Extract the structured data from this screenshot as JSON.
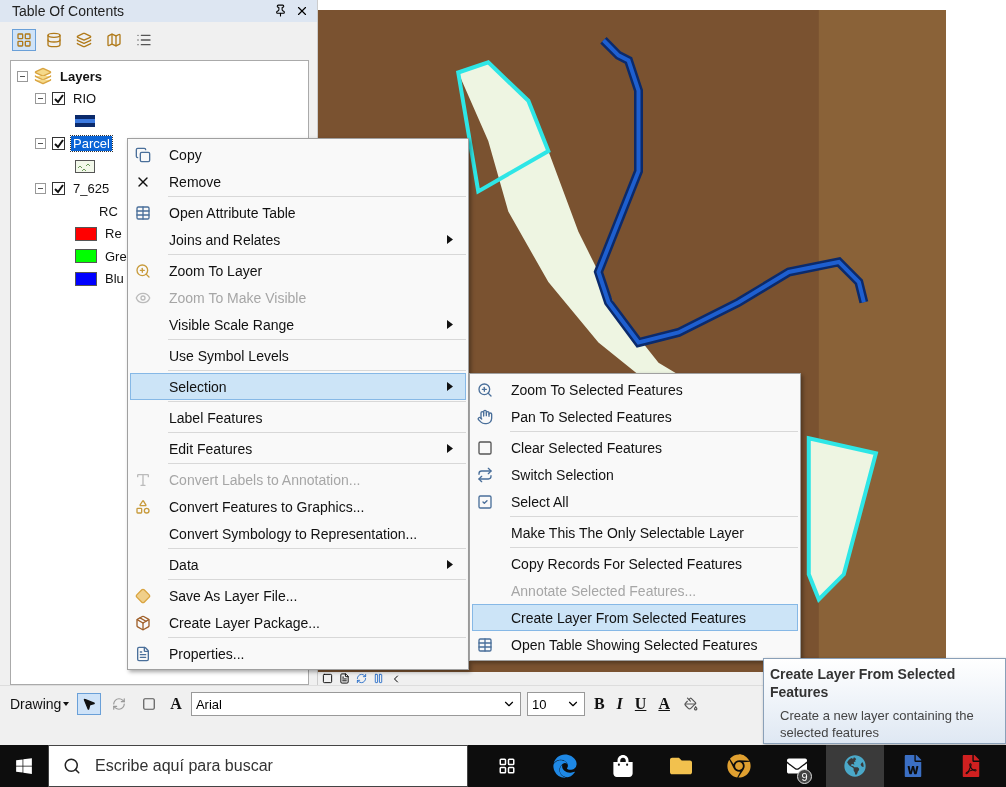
{
  "toc": {
    "title": "Table Of Contents",
    "tree": {
      "label": "Layers",
      "expanded": true,
      "children": [
        {
          "label": "RIO",
          "expanded": true,
          "checked": true,
          "selected": false,
          "children": [
            {
              "kind": "line"
            }
          ]
        },
        {
          "label": "Parcel",
          "expanded": true,
          "checked": true,
          "selected": true,
          "children": [
            {
              "kind": "pattern"
            }
          ]
        },
        {
          "label": "7_625",
          "expanded": true,
          "checked": true,
          "selected": false,
          "children": [
            {
              "kind": "heading",
              "label": "RC"
            },
            {
              "kind": "swatch",
              "label": "Re",
              "color": "#ff0000"
            },
            {
              "kind": "swatch",
              "label": "Gre",
              "color": "#00ff00"
            },
            {
              "kind": "swatch",
              "label": "Blu",
              "color": "#0000ff"
            }
          ]
        }
      ]
    }
  },
  "context_menu": {
    "groups": [
      [
        {
          "label": "Copy",
          "disabled": false,
          "has_submenu": false,
          "selected": false
        },
        {
          "label": "Remove",
          "disabled": false,
          "has_submenu": false,
          "selected": false
        }
      ],
      [
        {
          "label": "Open Attribute Table",
          "disabled": false,
          "has_submenu": false,
          "selected": false
        },
        {
          "label": "Joins and Relates",
          "disabled": false,
          "has_submenu": true,
          "selected": false
        }
      ],
      [
        {
          "label": "Zoom To Layer",
          "disabled": false,
          "has_submenu": false,
          "selected": false
        },
        {
          "label": "Zoom To Make Visible",
          "disabled": true,
          "has_submenu": false,
          "selected": false
        },
        {
          "label": "Visible Scale Range",
          "disabled": false,
          "has_submenu": true,
          "selected": false
        }
      ],
      [
        {
          "label": "Use Symbol Levels",
          "disabled": false,
          "has_submenu": false,
          "selected": false
        }
      ],
      [
        {
          "label": "Selection",
          "disabled": false,
          "has_submenu": true,
          "selected": true
        }
      ],
      [
        {
          "label": "Label Features",
          "disabled": false,
          "has_submenu": false,
          "selected": false
        }
      ],
      [
        {
          "label": "Edit Features",
          "disabled": false,
          "has_submenu": true,
          "selected": false
        }
      ],
      [
        {
          "label": "Convert Labels to Annotation...",
          "disabled": true,
          "has_submenu": false,
          "selected": false
        },
        {
          "label": "Convert Features to Graphics...",
          "disabled": false,
          "has_submenu": false,
          "selected": false
        },
        {
          "label": "Convert Symbology to Representation...",
          "disabled": false,
          "has_submenu": false,
          "selected": false
        }
      ],
      [
        {
          "label": "Data",
          "disabled": false,
          "has_submenu": true,
          "selected": false
        }
      ],
      [
        {
          "label": "Save As Layer File...",
          "disabled": false,
          "has_submenu": false,
          "selected": false
        },
        {
          "label": "Create Layer Package...",
          "disabled": false,
          "has_submenu": false,
          "selected": false
        }
      ],
      [
        {
          "label": "Properties...",
          "disabled": false,
          "has_submenu": false,
          "selected": false
        }
      ]
    ]
  },
  "submenu": {
    "groups": [
      [
        {
          "label": "Zoom To Selected Features",
          "disabled": false,
          "selected": false
        },
        {
          "label": "Pan To Selected Features",
          "disabled": false,
          "selected": false
        }
      ],
      [
        {
          "label": "Clear Selected Features",
          "disabled": false,
          "selected": false
        },
        {
          "label": "Switch Selection",
          "disabled": false,
          "selected": false
        },
        {
          "label": "Select All",
          "disabled": false,
          "selected": false
        }
      ],
      [
        {
          "label": "Make This The Only Selectable Layer",
          "disabled": false,
          "selected": false
        }
      ],
      [
        {
          "label": "Copy Records For Selected Features",
          "disabled": false,
          "selected": false
        },
        {
          "label": "Annotate Selected Features...",
          "disabled": true,
          "selected": false
        },
        {
          "label": "Create Layer From Selected Features",
          "disabled": false,
          "selected": true
        },
        {
          "label": "Open Table Showing Selected Features",
          "disabled": false,
          "selected": false
        }
      ]
    ]
  },
  "tooltip": {
    "title": "Create Layer From Selected Features",
    "text": "Create a new layer containing the selected features"
  },
  "drawing_toolbar": {
    "label": "Drawing",
    "font": "Arial",
    "size": "10",
    "bold": "B",
    "italic": "I",
    "underline": "U",
    "font_color": "A",
    "text_tool": "A"
  },
  "taskbar": {
    "search_placeholder": "Escribe aquí para buscar",
    "mail_badge": "9"
  }
}
